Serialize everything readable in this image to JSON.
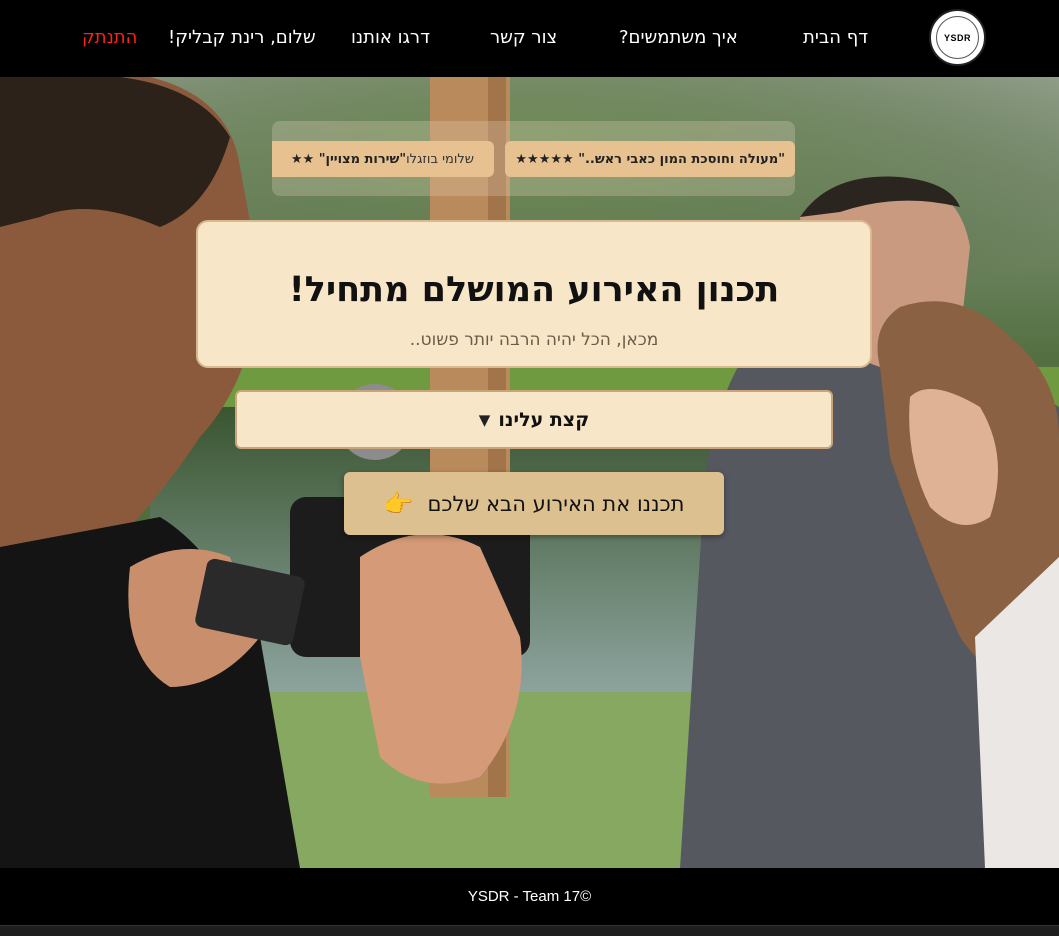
{
  "logo": {
    "text": "YSDR"
  },
  "nav": {
    "home": "דף הבית",
    "how": "איך משתמשים?",
    "contact": "צור קשר",
    "rate": "דרגו אותנו",
    "greeting": "שלום, רינת קבליק!",
    "logout": "התנתק"
  },
  "reviews": [
    {
      "quote": "\"מעולה וחוסכת המון כאבי ראש..\" ★★★★★",
      "author": ""
    },
    {
      "quote": "\"שירות מצויין\" ★★",
      "author": "שלומי בוזגלו"
    }
  ],
  "hero": {
    "title": "תכנון האירוע המושלם מתחיל!",
    "subtitle": "מכאן, הכל יהיה הרבה יותר פשוט..",
    "about_label": "קצת עלינו",
    "about_caret": "▼",
    "cta_label": "תכננו את האירוע הבא שלכם",
    "cta_icon": "👉"
  },
  "footer": {
    "text": "YSDR - Team 17©"
  }
}
